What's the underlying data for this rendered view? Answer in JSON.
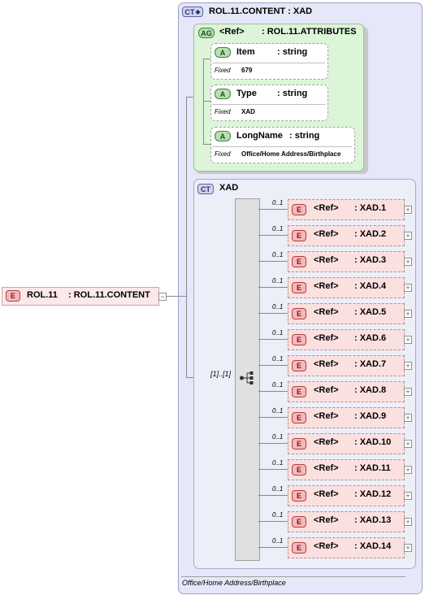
{
  "root_element": {
    "badge": "E",
    "name": "ROL.11",
    "type": ": ROL.11.CONTENT",
    "toggle": "−"
  },
  "complex_type": {
    "badge": "CT",
    "title": "ROL.11.CONTENT : XAD",
    "annotation": "Office/Home Address/Birthplace"
  },
  "attribute_group": {
    "badge": "AG",
    "ref": "<Ref>",
    "name": ": ROL.11.ATTRIBUTES"
  },
  "attributes": [
    {
      "badge": "A",
      "name": "Item",
      "type": ": string",
      "fixed_label": "Fixed",
      "fixed_value": "679"
    },
    {
      "badge": "A",
      "name": "Type",
      "type": ": string",
      "fixed_label": "Fixed",
      "fixed_value": "XAD"
    },
    {
      "badge": "A",
      "name": "LongName",
      "type": ": string",
      "fixed_label": "Fixed",
      "fixed_value": "Office/Home Address/Birthplace"
    }
  ],
  "xad_type": {
    "badge": "CT",
    "title": "XAD",
    "sequence_cardinality": "[1]..[1]",
    "sequence_icon": "sequence-icon"
  },
  "children": [
    {
      "cardinality": "0..1",
      "badge": "E",
      "ref": "<Ref>",
      "name": ": XAD.1"
    },
    {
      "cardinality": "0..1",
      "badge": "E",
      "ref": "<Ref>",
      "name": ": XAD.2"
    },
    {
      "cardinality": "0..1",
      "badge": "E",
      "ref": "<Ref>",
      "name": ": XAD.3"
    },
    {
      "cardinality": "0..1",
      "badge": "E",
      "ref": "<Ref>",
      "name": ": XAD.4"
    },
    {
      "cardinality": "0..1",
      "badge": "E",
      "ref": "<Ref>",
      "name": ": XAD.5"
    },
    {
      "cardinality": "0..1",
      "badge": "E",
      "ref": "<Ref>",
      "name": ": XAD.6"
    },
    {
      "cardinality": "0..1",
      "badge": "E",
      "ref": "<Ref>",
      "name": ": XAD.7"
    },
    {
      "cardinality": "0..1",
      "badge": "E",
      "ref": "<Ref>",
      "name": ": XAD.8"
    },
    {
      "cardinality": "0..1",
      "badge": "E",
      "ref": "<Ref>",
      "name": ": XAD.9"
    },
    {
      "cardinality": "0..1",
      "badge": "E",
      "ref": "<Ref>",
      "name": ": XAD.10"
    },
    {
      "cardinality": "0..1",
      "badge": "E",
      "ref": "<Ref>",
      "name": ": XAD.11"
    },
    {
      "cardinality": "0..1",
      "badge": "E",
      "ref": "<Ref>",
      "name": ": XAD.12"
    },
    {
      "cardinality": "0..1",
      "badge": "E",
      "ref": "<Ref>",
      "name": ": XAD.13"
    },
    {
      "cardinality": "0..1",
      "badge": "E",
      "ref": "<Ref>",
      "name": ": XAD.14"
    }
  ],
  "expand_glyph": "+"
}
